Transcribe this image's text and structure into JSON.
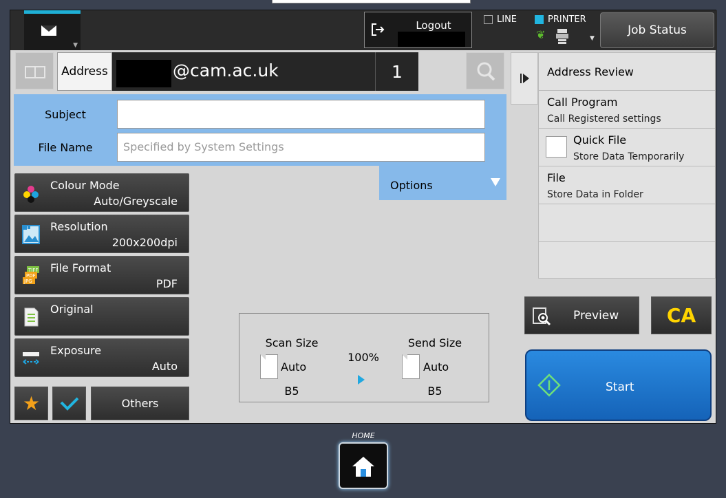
{
  "topbar": {
    "logout_label": "Logout",
    "line_label": "LINE",
    "printer_label": "PRINTER",
    "job_status_label": "Job Status"
  },
  "address": {
    "label": "Address",
    "value": "@cam.ac.uk",
    "count": "1"
  },
  "fields": {
    "subject_label": "Subject",
    "subject_value": "",
    "file_name_label": "File Name",
    "file_name_placeholder": "Specified by System Settings",
    "options_label": "Options"
  },
  "settings": [
    {
      "name": "Colour Mode",
      "value": "Auto/Greyscale"
    },
    {
      "name": "Resolution",
      "value": "200x200dpi"
    },
    {
      "name": "File Format",
      "value": "PDF"
    },
    {
      "name": "Original",
      "value": ""
    },
    {
      "name": "Exposure",
      "value": "Auto"
    }
  ],
  "others_label": "Others",
  "scan": {
    "scan_size_label": "Scan Size",
    "scan_size_value": "Auto",
    "scan_paper": "B5",
    "ratio": "100%",
    "send_size_label": "Send Size",
    "send_size_value": "Auto",
    "send_paper": "B5"
  },
  "sidemenu": {
    "address_review": "Address Review",
    "call_program": "Call Program",
    "call_program_sub": "Call Registered settings",
    "quick_file": "Quick File",
    "quick_file_sub": "Store Data Temporarily",
    "file": "File",
    "file_sub": "Store Data in Folder"
  },
  "actions": {
    "preview_label": "Preview",
    "ca_label": "CA",
    "start_label": "Start"
  },
  "home_label": "HOME",
  "colors": {
    "accent_blue": "#86b9ea",
    "start_blue": "#1f75cf",
    "ca_yellow": "#ffd400",
    "tab_cyan": "#1fb0d6"
  },
  "file_format_icon_text": [
    "TIFF",
    "PDF",
    "JPG"
  ]
}
